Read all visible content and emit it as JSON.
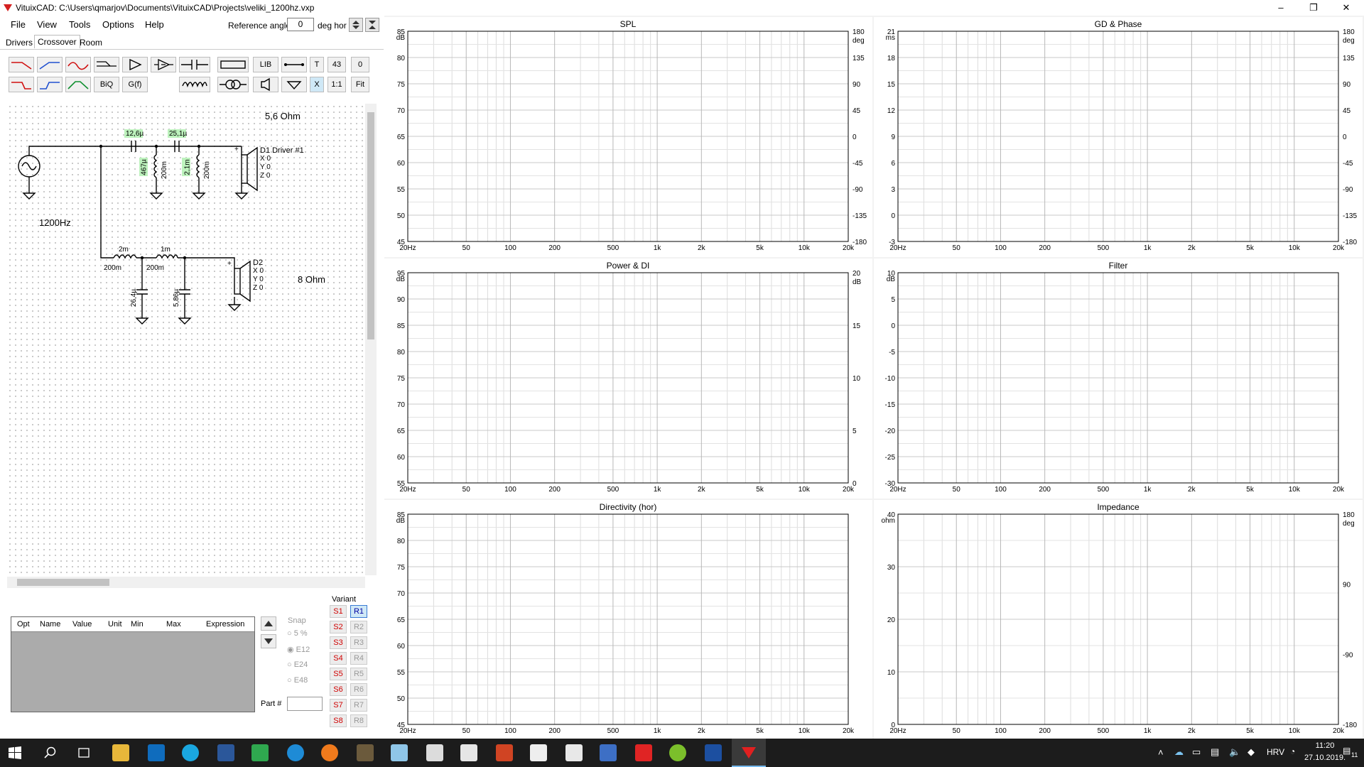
{
  "window": {
    "title": "VituixCAD: C:\\Users\\qmarjov\\Documents\\VituixCAD\\Projects\\veliki_1200hz.vxp",
    "min": "–",
    "max": "❐",
    "close": "✕"
  },
  "menu": [
    "File",
    "View",
    "Tools",
    "Options",
    "Help"
  ],
  "reference": {
    "label": "Reference angle",
    "value": "0",
    "unit": "deg hor"
  },
  "tabs": [
    "Drivers",
    "Crossover",
    "Room"
  ],
  "toolbar": {
    "lib": "LIB",
    "t": "T",
    "n1": "43",
    "n2": "0",
    "biq": "BiQ",
    "gf": "G(f)",
    "x": "X",
    "ratio": "1:1",
    "fit": "Fit"
  },
  "schematic": {
    "hf_impedance": "5,6 Ohm",
    "lf_impedance": "8 Ohm",
    "freq": "1200Hz",
    "c1": "12,6µ",
    "c2": "25,1µ",
    "l1": "467µ",
    "r1": "200m",
    "l2": "2,1m",
    "r2": "200m",
    "d1": "D1 Driver #1",
    "d2": "D2",
    "xyz": [
      "X 0",
      "Y 0",
      "Z 0"
    ],
    "l3": "2m",
    "r3": "200m",
    "l4": "1m",
    "r4": "200m",
    "c3": "26,4µ",
    "c4": "5,86µ"
  },
  "params": {
    "headers": [
      "Opt",
      "Name",
      "Value",
      "Unit",
      "Min",
      "Max",
      "Expression"
    ],
    "snap": "Snap",
    "snap_opts": [
      "5 %",
      "E12",
      "E24",
      "E48"
    ],
    "part": "Part #"
  },
  "variant": {
    "label": "Variant",
    "s": [
      "S1",
      "S2",
      "S3",
      "S4",
      "S5",
      "S6",
      "S7",
      "S8"
    ],
    "r": [
      "R1",
      "R2",
      "R3",
      "R4",
      "R5",
      "R6",
      "R7",
      "R8"
    ]
  },
  "xticks": [
    "20Hz",
    "50",
    "100",
    "200",
    "500",
    "1k",
    "2k",
    "5k",
    "10k",
    "20k"
  ],
  "charts": [
    {
      "title": "SPL",
      "yunit": "dB",
      "yticks": [
        "85",
        "80",
        "75",
        "70",
        "65",
        "60",
        "55",
        "50",
        "45"
      ],
      "y2unit": "deg",
      "y2ticks": [
        "180",
        "135",
        "90",
        "45",
        "0",
        "-45",
        "-90",
        "-135",
        "-180"
      ]
    },
    {
      "title": "GD & Phase",
      "yunit": "ms",
      "yticks": [
        "21",
        "18",
        "15",
        "12",
        "9",
        "6",
        "3",
        "0",
        "-3"
      ],
      "y2unit": "deg",
      "y2ticks": [
        "180",
        "135",
        "90",
        "45",
        "0",
        "-45",
        "-90",
        "-135",
        "-180"
      ]
    },
    {
      "title": "Power & DI",
      "yunit": "dB",
      "yticks": [
        "95",
        "90",
        "85",
        "80",
        "75",
        "70",
        "65",
        "60",
        "55"
      ],
      "y2unit": "dB",
      "y2ticks": [
        "20",
        "15",
        "10",
        "5",
        "0"
      ]
    },
    {
      "title": "Filter",
      "yunit": "dB",
      "yticks": [
        "10",
        "5",
        "0",
        "-5",
        "-10",
        "-15",
        "-20",
        "-25",
        "-30"
      ],
      "y2unit": "",
      "y2ticks": []
    },
    {
      "title": "Directivity (hor)",
      "yunit": "dB",
      "yticks": [
        "85",
        "80",
        "75",
        "70",
        "65",
        "60",
        "55",
        "50",
        "45"
      ],
      "y2unit": "",
      "y2ticks": []
    },
    {
      "title": "Impedance",
      "yunit": "ohm",
      "yticks": [
        "40",
        "30",
        "20",
        "10",
        "0"
      ],
      "y2unit": "deg",
      "y2ticks": [
        "180",
        "90",
        "-90",
        "-180"
      ]
    }
  ],
  "tray": {
    "lang": "HRV",
    "time": "11:20",
    "date": "27.10.2019.",
    "notif": "11"
  },
  "colors": {
    "spl": "#9b2a1e",
    "blue": "#0018d0",
    "magenta": "#e040e0",
    "red": "#e0303a",
    "gray": "#555555",
    "lightgray": "#9a9a9a"
  }
}
